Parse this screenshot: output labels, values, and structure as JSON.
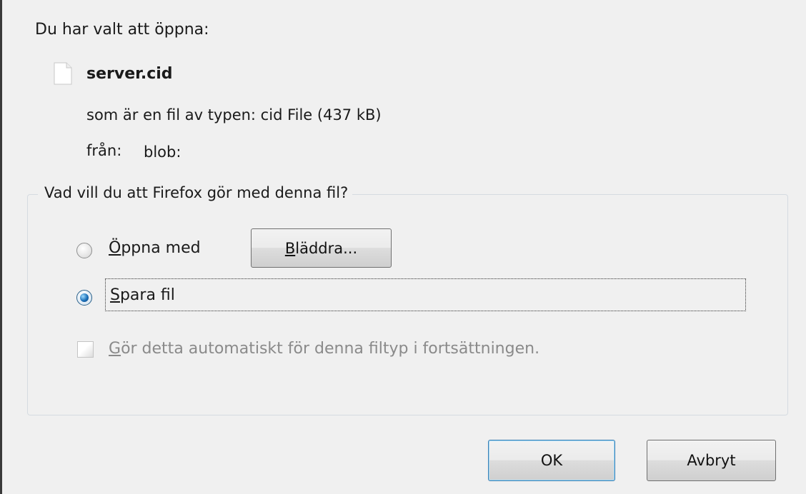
{
  "dialog": {
    "intro": "Du har valt att öppna:",
    "file": {
      "icon": "file-icon",
      "name": "server.cid",
      "type_text": "som är en fil av typen:  cid File (437 kB)",
      "from_label": "från:",
      "from_value": "blob:"
    },
    "action_group": {
      "legend": "Vad vill du att Firefox gör med denna fil?",
      "open_with": {
        "mnemonic": "Ö",
        "rest": "ppna med",
        "selected": false
      },
      "browse_button": {
        "mnemonic": "B",
        "rest": "läddra..."
      },
      "save_file": {
        "mnemonic": "S",
        "rest": "para fil",
        "selected": true
      },
      "auto_checkbox": {
        "mnemonic": "G",
        "rest": "ör detta automatiskt för denna filtyp i fortsättningen.",
        "checked": false,
        "enabled": false
      }
    },
    "buttons": {
      "ok": "OK",
      "cancel": "Avbryt"
    },
    "colors": {
      "background": "#f0f0f0",
      "focus_accent": "#3c7fb1",
      "disabled_text": "#8a8a8a"
    }
  }
}
